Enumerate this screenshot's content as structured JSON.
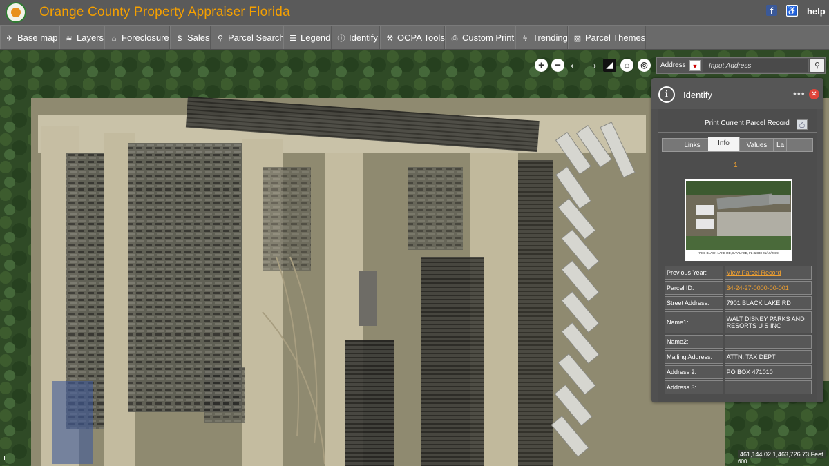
{
  "header": {
    "title": "Orange County Property Appraiser Florida",
    "facebook_icon": "f",
    "accessibility_icon": "♿",
    "help": "help"
  },
  "toolbar": {
    "items": [
      {
        "label": "Base map",
        "icon": "plane-icon"
      },
      {
        "label": "Layers",
        "icon": "layers-icon"
      },
      {
        "label": "Foreclosure",
        "icon": "house-icon"
      },
      {
        "label": "Sales",
        "icon": "dollar-icon"
      },
      {
        "label": "Parcel Search",
        "icon": "search-icon"
      },
      {
        "label": "Legend",
        "icon": "list-icon"
      },
      {
        "label": "Identify",
        "icon": "info-icon"
      },
      {
        "label": "OCPA Tools",
        "icon": "wrench-icon"
      },
      {
        "label": "Custom Print",
        "icon": "printer-icon"
      },
      {
        "label": "Trending",
        "icon": "bolt-icon"
      },
      {
        "label": "Parcel Themes",
        "icon": "image-icon"
      }
    ]
  },
  "search": {
    "label": "Address",
    "placeholder": "Input Address"
  },
  "identify": {
    "title": "Identify",
    "print_label": "Print Current Parcel Record",
    "tabs": [
      "Links",
      "Info",
      "Values",
      "La"
    ],
    "active_tab": "Info",
    "page": "1",
    "photo_caption": "7901 BLACK LAKE RD, BAY LAKE, FL 32830   01/19/2019",
    "rows": [
      {
        "label": "Previous Year:",
        "value": "View Parcel Record",
        "link": true
      },
      {
        "label": "Parcel ID:",
        "value": "34-24-27-0000-00-001",
        "link": true
      },
      {
        "label": "Street Address:",
        "value": "7901 BLACK LAKE RD",
        "link": false
      },
      {
        "label": "Name1:",
        "value": "WALT DISNEY PARKS AND RESORTS U S INC",
        "link": false
      },
      {
        "label": "Name2:",
        "value": "",
        "link": false
      },
      {
        "label": "Mailing Address:",
        "value": "ATTN: TAX DEPT",
        "link": false
      },
      {
        "label": "Address 2:",
        "value": "PO BOX 471010",
        "link": false
      },
      {
        "label": "Address 3:",
        "value": "",
        "link": false
      }
    ]
  },
  "map": {
    "coordinates": "461,144.02 1,463,726.73 Feet",
    "scale": "600"
  },
  "colors": {
    "title_orange": "#f5a000",
    "link_orange": "#f0a030",
    "toolbar_gray": "#6a6a6a",
    "panel_gray": "#505050"
  }
}
